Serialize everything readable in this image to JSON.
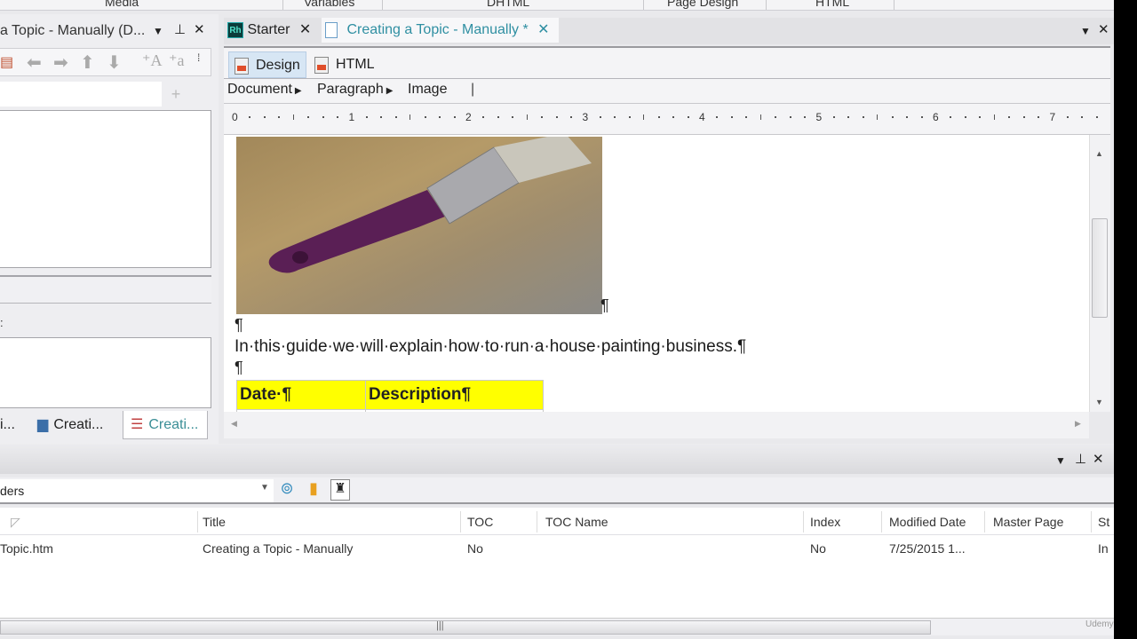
{
  "ribbon": {
    "labels": [
      "Media",
      "Variables",
      "DHTML",
      "Page Design",
      "HTML"
    ]
  },
  "left_pane": {
    "title": "a Topic - Manually (D...",
    "toolbar_icons": [
      "structure-icon",
      "arrow-left-icon",
      "arrow-right-icon",
      "arrow-up-icon",
      "arrow-down-icon",
      "increase-font-icon",
      "decrease-font-icon",
      "overflow-icon"
    ],
    "colon_label": ":",
    "bottom_tabs": [
      {
        "label": "i..."
      },
      {
        "label": "Creati..."
      },
      {
        "label": "Creati...",
        "active": true
      }
    ]
  },
  "document_tabs": [
    {
      "label": "Starter",
      "icon": "Rh",
      "closable": true
    },
    {
      "label": "Creating a Topic - Manually *",
      "active": true,
      "closable": true
    }
  ],
  "view_modes": [
    {
      "label": "Design",
      "active": true
    },
    {
      "label": "HTML",
      "active": false
    }
  ],
  "breadcrumb": [
    "Document",
    "Paragraph",
    "Image"
  ],
  "ruler": {
    "labels": [
      "0",
      "1",
      "2",
      "3",
      "4",
      "5",
      "6",
      "7"
    ],
    "unit": "inches"
  },
  "document": {
    "image_description": "purple paintbrush on wooden surface",
    "pilcrow": "¶",
    "body_text": "In·this·guide·we·will·explain·how·to·run·a·house·painting·business.¶",
    "table": {
      "headers": [
        "Date·¶",
        "Description¶"
      ],
      "header_bg": "#ffff00"
    }
  },
  "bottom_pane": {
    "filter_value": "ders",
    "toolbar_icons": [
      "view-icon",
      "bookmark-icon",
      "find-icon"
    ],
    "columns": [
      "",
      "Title",
      "TOC",
      "TOC Name",
      "Index",
      "Modified Date",
      "Master Page",
      "St"
    ],
    "rows": [
      [
        "Topic.htm",
        "Creating a Topic - Manually",
        "No",
        "",
        "No",
        "7/25/2015 1...",
        "",
        "In"
      ]
    ]
  },
  "watermark": "Udemy"
}
